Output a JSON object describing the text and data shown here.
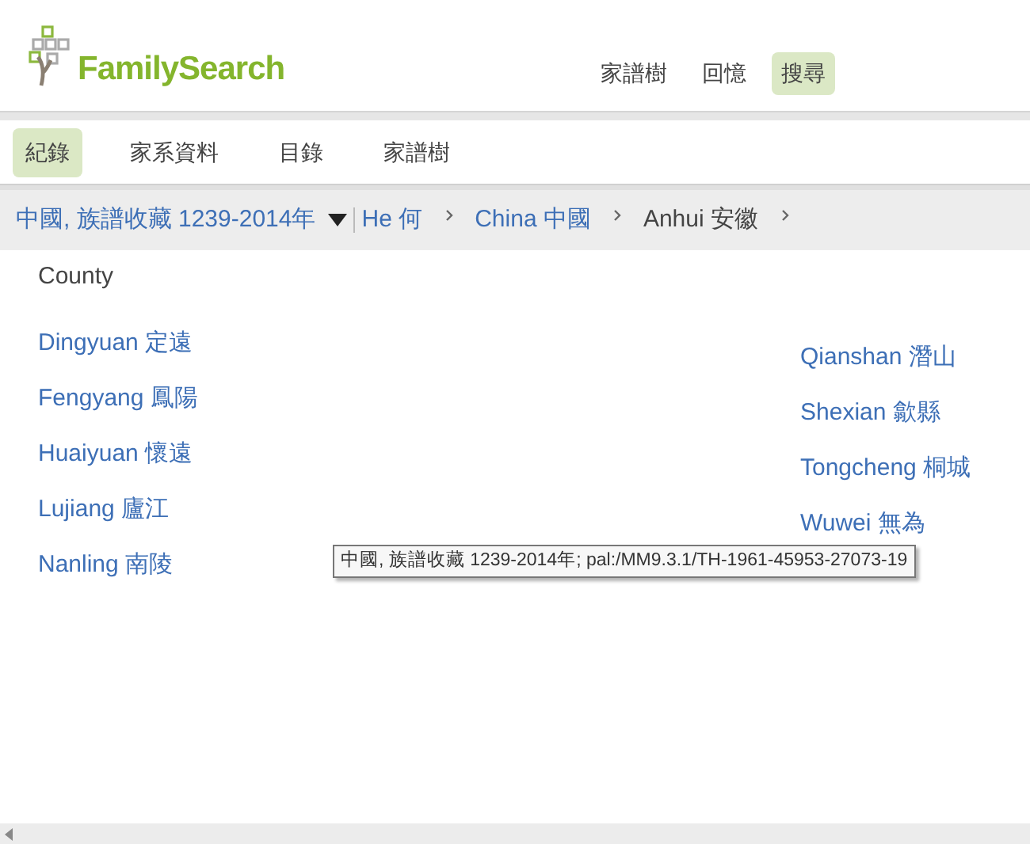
{
  "logo": {
    "text": "FamilySearch"
  },
  "top_nav": [
    {
      "label": "家譜樹",
      "selected": false
    },
    {
      "label": "回憶",
      "selected": false
    },
    {
      "label": "搜尋",
      "selected": true
    }
  ],
  "sub_nav": [
    {
      "label": "紀錄",
      "selected": true
    },
    {
      "label": "家系資料",
      "selected": false
    },
    {
      "label": "目錄",
      "selected": false
    },
    {
      "label": "家譜樹",
      "selected": false
    }
  ],
  "breadcrumb": {
    "collection": "中國, 族譜收藏 1239-2014年",
    "items": [
      {
        "label": "He 何",
        "link": true
      },
      {
        "label": "China 中國",
        "link": true
      },
      {
        "label": "Anhui 安徽",
        "link": false
      }
    ]
  },
  "heading": "County",
  "columns": [
    [
      "Dingyuan 定遠",
      "Fengyang 鳳陽",
      "Huaiyuan 懷遠",
      "Lujiang 廬江",
      "Nanling 南陵"
    ],
    [
      "Qianshan 潛山",
      "Shexian 歙縣",
      "Tongcheng 桐城",
      "Wuwei 無為"
    ]
  ],
  "tooltip": "中國, 族譜收藏 1239-2014年; pal:/MM9.3.1/TH-1961-45953-27073-19"
}
